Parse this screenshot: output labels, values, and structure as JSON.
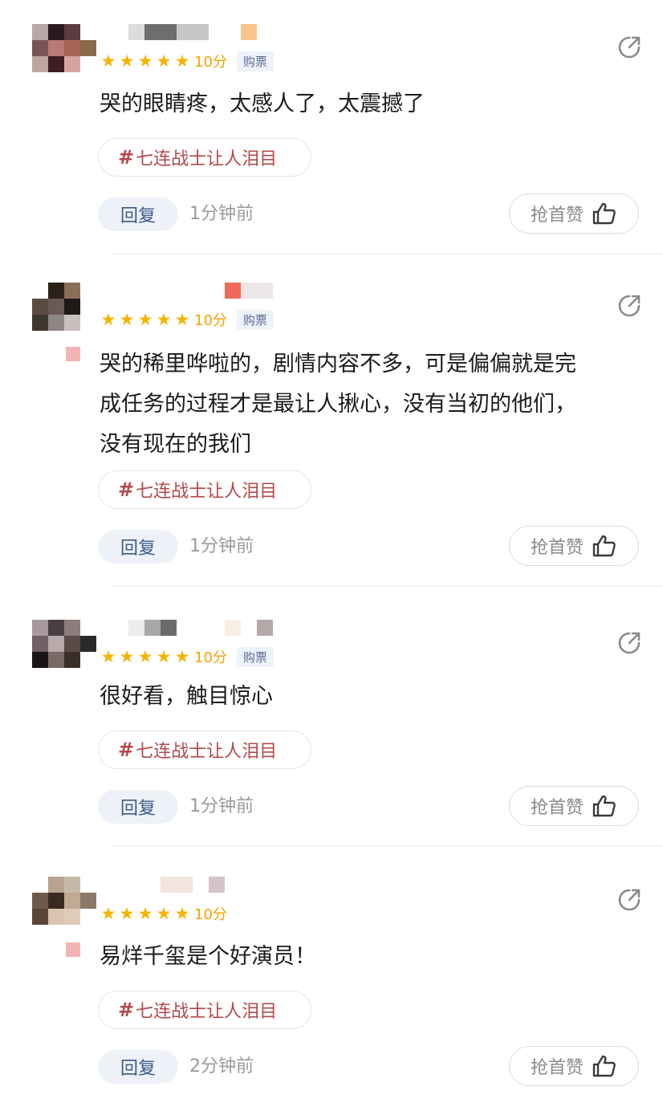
{
  "comments": [
    {
      "score": "10分",
      "ticket_badge": "购票",
      "text_lines": [
        "哭的眼睛疼，太感人了，太震撼了"
      ],
      "topic": "七连战士让人泪目",
      "reply_label": "回复",
      "time": "1分钟前",
      "like_label": "抢首赞"
    },
    {
      "score": "10分",
      "ticket_badge": "购票",
      "text_lines": [
        "哭的稀里哗啦的，剧情内容不多，可是偏偏就是完",
        "成任务的过程才是最让人揪心，没有当初的他们，",
        "没有现在的我们"
      ],
      "topic": "七连战士让人泪目",
      "reply_label": "回复",
      "time": "1分钟前",
      "like_label": "抢首赞"
    },
    {
      "score": "10分",
      "ticket_badge": "购票",
      "text_lines": [
        "很好看，触目惊心"
      ],
      "topic": "七连战士让人泪目",
      "reply_label": "回复",
      "time": "1分钟前",
      "like_label": "抢首赞"
    },
    {
      "score": "10分",
      "ticket_badge": "",
      "text_lines": [
        "易烊千玺是个好演员！"
      ],
      "topic": "七连战士让人泪目",
      "reply_label": "回复",
      "time": "2分钟前",
      "like_label": "抢首赞"
    }
  ],
  "topic_hash": "#",
  "star_rating": 5,
  "colors": {
    "star": "#f5b300",
    "topic_text": "#b24a4a",
    "reply_bg": "#eef2f8"
  },
  "icons": {
    "share": "share-icon",
    "thumb": "thumbs-up-icon",
    "star": "star-icon"
  }
}
